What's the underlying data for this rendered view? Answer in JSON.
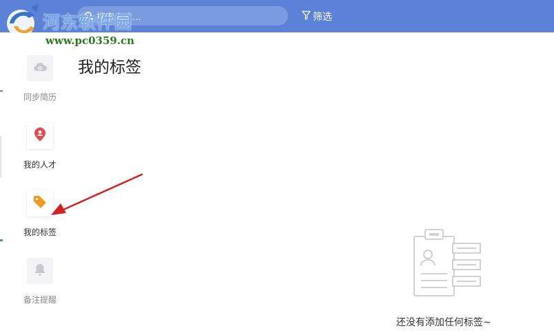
{
  "watermark": {
    "line1": "河东软件园",
    "line2": "www.pc0359.cn"
  },
  "header": {
    "search_placeholder": "搜索人才...",
    "filter_label": "筛选"
  },
  "sidebar": {
    "items": [
      {
        "label": "同步简历",
        "icon": "cloud-sync-icon",
        "active": false
      },
      {
        "label": "我的人才",
        "icon": "person-pin-icon",
        "active": false,
        "color": "#e8474b"
      },
      {
        "label": "我的标签",
        "icon": "tag-icon",
        "active": true,
        "color": "#f39a1e"
      },
      {
        "label": "备注提醒",
        "icon": "bell-icon",
        "active": false
      }
    ]
  },
  "main": {
    "title": "我的标签",
    "empty_message": "还没有添加任何标签~"
  },
  "colors": {
    "header_bg": "#5b82d6",
    "arrow": "#d42020"
  }
}
